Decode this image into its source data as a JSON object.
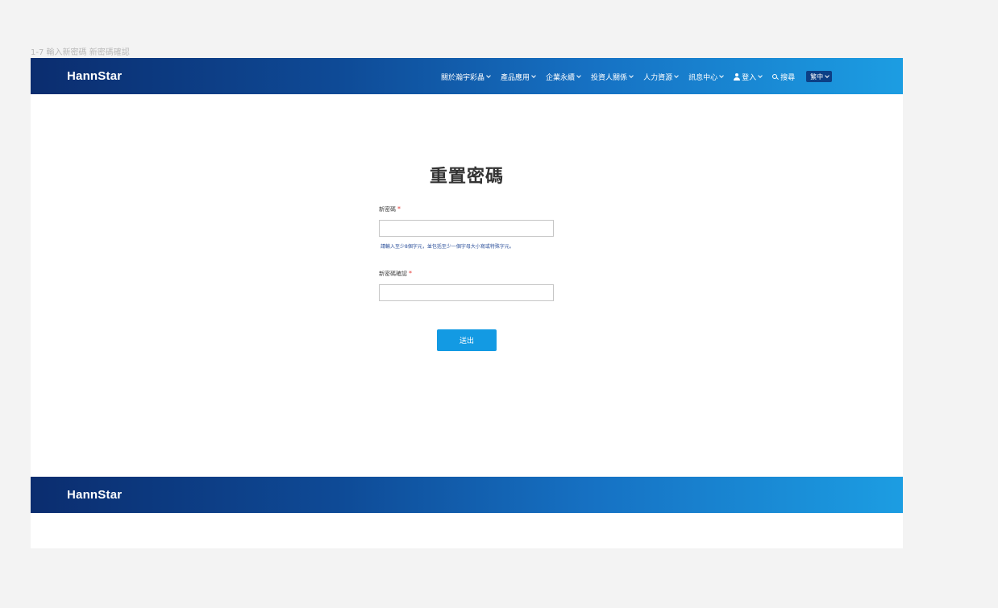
{
  "frame_label": "1-7 輸入新密碼 新密碼確認",
  "header": {
    "logo": "HannStar",
    "nav_items": [
      {
        "label": "關於瀚宇彩晶"
      },
      {
        "label": "產品應用"
      },
      {
        "label": "企業永續"
      },
      {
        "label": "投資人關係"
      },
      {
        "label": "人力資源"
      },
      {
        "label": "訊息中心"
      }
    ],
    "login_label": "登入",
    "search_label": "搜尋",
    "language_label": "繁中"
  },
  "form": {
    "title": "重置密碼",
    "new_password_label": "新密碼",
    "new_password_value": "",
    "required_mark": "*",
    "password_hint": "請輸入至少8個字元，並包括至少一個字母大小寫或特殊字元。",
    "confirm_password_label": "新密碼確認",
    "confirm_password_value": "",
    "submit_label": "送出"
  },
  "footer": {
    "logo": "HannStar"
  },
  "colors": {
    "header_gradient_start": "#0b2d6f",
    "header_gradient_end": "#1c9de2",
    "submit_button": "#139ae3",
    "required_mark": "#e53935",
    "hint_text": "#2b4f9a",
    "language_button": "#0c3f86"
  },
  "icons": {
    "user": "user-icon",
    "search": "search-icon",
    "dropdown": "chevron-down-icon"
  }
}
